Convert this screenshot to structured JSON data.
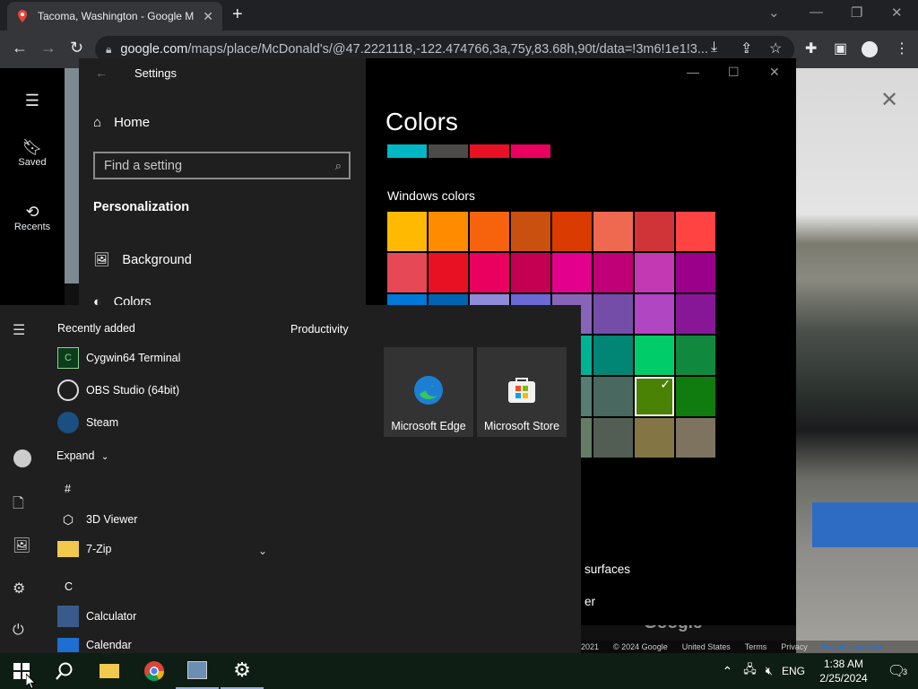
{
  "chrome": {
    "tab_title": "Tacoma, Washington - Google M",
    "url_host": "google.com",
    "url_path": "/maps/place/McDonald's/@47.2221118,-122.474766,3a,75y,83.68h,90t/data=!3m6!1e1!3...",
    "new_tab": "+"
  },
  "maps": {
    "saved_label": "Saved",
    "recents_label": "Recents",
    "watermark": "Google",
    "footer": [
      "2021",
      "© 2024 Google",
      "United States",
      "Terms",
      "Privacy",
      "Report a problem"
    ]
  },
  "settings": {
    "window_title": "Settings",
    "home": "Home",
    "search_placeholder": "Find a setting",
    "section": "Personalization",
    "nav": [
      "Background",
      "Colors"
    ],
    "page_title": "Colors",
    "preview_colors": [
      "#00b7c3",
      "#4c4a48",
      "#e81123",
      "#ea005e"
    ],
    "windows_colors_label": "Windows colors",
    "swatches": [
      "#ffb900",
      "#ff8c00",
      "#f7630c",
      "#ca5010",
      "#da3b01",
      "#ef6950",
      "#d13438",
      "#ff4343",
      "#e74856",
      "#e81123",
      "#ea005e",
      "#c30052",
      "#e3008c",
      "#bf0077",
      "#c239b3",
      "#9a0089",
      "#0078d7",
      "#0063b1",
      "#8e8cd8",
      "#6b69d6",
      "#8764b8",
      "#744da9",
      "#b146c2",
      "#881798",
      "#0099bc",
      "#2d7d9a",
      "#00b7c3",
      "#038387",
      "#00b294",
      "#018574",
      "#00cc6a",
      "#10893e",
      "#7a7574",
      "#5d5a58",
      "#68768a",
      "#515c6b",
      "#567c73",
      "#486860",
      "#498205",
      "#107c10",
      "#767676",
      "#4c4a48",
      "#69797e",
      "#4a5459",
      "#647c64",
      "#525e54",
      "#847545",
      "#7e735f"
    ],
    "selected_swatch": "#498205",
    "partial_text_surfaces": "surfaces",
    "partial_text_er": "er"
  },
  "start": {
    "recently_added": "Recently added",
    "recent_apps": [
      "Cygwin64 Terminal",
      "OBS Studio (64bit)",
      "Steam"
    ],
    "expand": "Expand",
    "letter_hash": "#",
    "hash_apps": [
      "3D Viewer",
      "7-Zip"
    ],
    "letter_c": "C",
    "c_apps": [
      "Calculator",
      "Calendar"
    ],
    "productivity": "Productivity",
    "tiles": [
      "Microsoft Edge",
      "Microsoft Store"
    ]
  },
  "taskbar": {
    "lang": "ENG",
    "time": "1:38 AM",
    "date": "2/25/2024",
    "notification_count": "3"
  }
}
